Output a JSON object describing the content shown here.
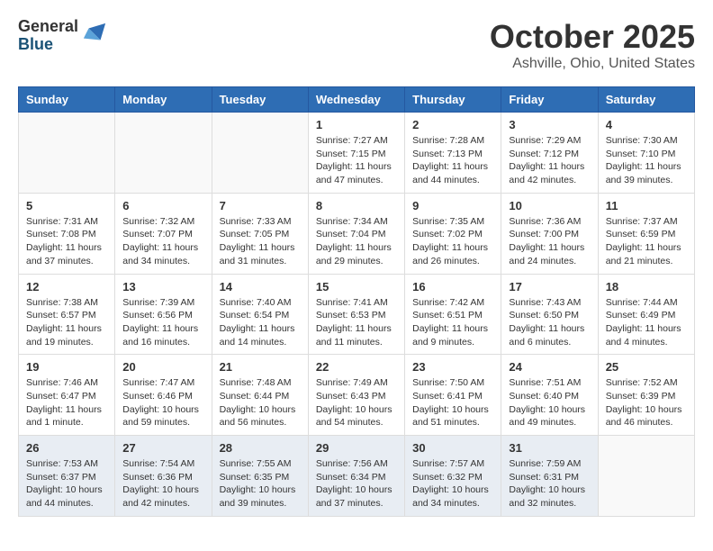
{
  "header": {
    "logo_general": "General",
    "logo_blue": "Blue",
    "month_title": "October 2025",
    "location": "Ashville, Ohio, United States"
  },
  "weekdays": [
    "Sunday",
    "Monday",
    "Tuesday",
    "Wednesday",
    "Thursday",
    "Friday",
    "Saturday"
  ],
  "weeks": [
    [
      {
        "day": "",
        "empty": true
      },
      {
        "day": "",
        "empty": true
      },
      {
        "day": "",
        "empty": true
      },
      {
        "day": "1",
        "info": "Sunrise: 7:27 AM\nSunset: 7:15 PM\nDaylight: 11 hours and 47 minutes."
      },
      {
        "day": "2",
        "info": "Sunrise: 7:28 AM\nSunset: 7:13 PM\nDaylight: 11 hours and 44 minutes."
      },
      {
        "day": "3",
        "info": "Sunrise: 7:29 AM\nSunset: 7:12 PM\nDaylight: 11 hours and 42 minutes."
      },
      {
        "day": "4",
        "info": "Sunrise: 7:30 AM\nSunset: 7:10 PM\nDaylight: 11 hours and 39 minutes."
      }
    ],
    [
      {
        "day": "5",
        "info": "Sunrise: 7:31 AM\nSunset: 7:08 PM\nDaylight: 11 hours and 37 minutes."
      },
      {
        "day": "6",
        "info": "Sunrise: 7:32 AM\nSunset: 7:07 PM\nDaylight: 11 hours and 34 minutes."
      },
      {
        "day": "7",
        "info": "Sunrise: 7:33 AM\nSunset: 7:05 PM\nDaylight: 11 hours and 31 minutes."
      },
      {
        "day": "8",
        "info": "Sunrise: 7:34 AM\nSunset: 7:04 PM\nDaylight: 11 hours and 29 minutes."
      },
      {
        "day": "9",
        "info": "Sunrise: 7:35 AM\nSunset: 7:02 PM\nDaylight: 11 hours and 26 minutes."
      },
      {
        "day": "10",
        "info": "Sunrise: 7:36 AM\nSunset: 7:00 PM\nDaylight: 11 hours and 24 minutes."
      },
      {
        "day": "11",
        "info": "Sunrise: 7:37 AM\nSunset: 6:59 PM\nDaylight: 11 hours and 21 minutes."
      }
    ],
    [
      {
        "day": "12",
        "info": "Sunrise: 7:38 AM\nSunset: 6:57 PM\nDaylight: 11 hours and 19 minutes."
      },
      {
        "day": "13",
        "info": "Sunrise: 7:39 AM\nSunset: 6:56 PM\nDaylight: 11 hours and 16 minutes."
      },
      {
        "day": "14",
        "info": "Sunrise: 7:40 AM\nSunset: 6:54 PM\nDaylight: 11 hours and 14 minutes."
      },
      {
        "day": "15",
        "info": "Sunrise: 7:41 AM\nSunset: 6:53 PM\nDaylight: 11 hours and 11 minutes."
      },
      {
        "day": "16",
        "info": "Sunrise: 7:42 AM\nSunset: 6:51 PM\nDaylight: 11 hours and 9 minutes."
      },
      {
        "day": "17",
        "info": "Sunrise: 7:43 AM\nSunset: 6:50 PM\nDaylight: 11 hours and 6 minutes."
      },
      {
        "day": "18",
        "info": "Sunrise: 7:44 AM\nSunset: 6:49 PM\nDaylight: 11 hours and 4 minutes."
      }
    ],
    [
      {
        "day": "19",
        "info": "Sunrise: 7:46 AM\nSunset: 6:47 PM\nDaylight: 11 hours and 1 minute."
      },
      {
        "day": "20",
        "info": "Sunrise: 7:47 AM\nSunset: 6:46 PM\nDaylight: 10 hours and 59 minutes."
      },
      {
        "day": "21",
        "info": "Sunrise: 7:48 AM\nSunset: 6:44 PM\nDaylight: 10 hours and 56 minutes."
      },
      {
        "day": "22",
        "info": "Sunrise: 7:49 AM\nSunset: 6:43 PM\nDaylight: 10 hours and 54 minutes."
      },
      {
        "day": "23",
        "info": "Sunrise: 7:50 AM\nSunset: 6:41 PM\nDaylight: 10 hours and 51 minutes."
      },
      {
        "day": "24",
        "info": "Sunrise: 7:51 AM\nSunset: 6:40 PM\nDaylight: 10 hours and 49 minutes."
      },
      {
        "day": "25",
        "info": "Sunrise: 7:52 AM\nSunset: 6:39 PM\nDaylight: 10 hours and 46 minutes."
      }
    ],
    [
      {
        "day": "26",
        "info": "Sunrise: 7:53 AM\nSunset: 6:37 PM\nDaylight: 10 hours and 44 minutes."
      },
      {
        "day": "27",
        "info": "Sunrise: 7:54 AM\nSunset: 6:36 PM\nDaylight: 10 hours and 42 minutes."
      },
      {
        "day": "28",
        "info": "Sunrise: 7:55 AM\nSunset: 6:35 PM\nDaylight: 10 hours and 39 minutes."
      },
      {
        "day": "29",
        "info": "Sunrise: 7:56 AM\nSunset: 6:34 PM\nDaylight: 10 hours and 37 minutes."
      },
      {
        "day": "30",
        "info": "Sunrise: 7:57 AM\nSunset: 6:32 PM\nDaylight: 10 hours and 34 minutes."
      },
      {
        "day": "31",
        "info": "Sunrise: 7:59 AM\nSunset: 6:31 PM\nDaylight: 10 hours and 32 minutes."
      },
      {
        "day": "",
        "empty": true
      }
    ]
  ]
}
